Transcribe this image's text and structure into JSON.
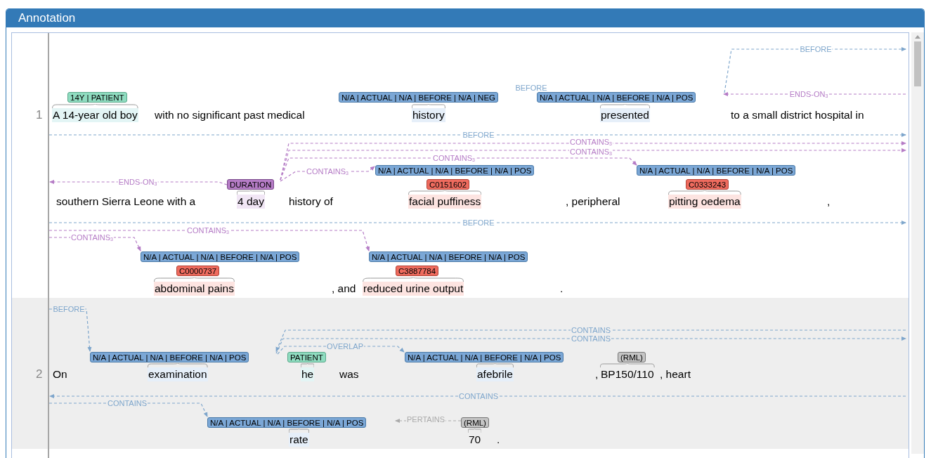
{
  "panel": {
    "title": "Annotation"
  },
  "lines": [
    {
      "number": "1",
      "shaded": false,
      "tokens": [
        {
          "text": "A 14-year old boy",
          "labels": [
            {
              "text": "14Y | PATIENT",
              "kind": "patient"
            }
          ]
        },
        {
          "text": "with no significant past medical"
        },
        {
          "text": "history",
          "labels": [
            {
              "text": "N/A | ACTUAL | N/A | BEFORE | N/A | NEG",
              "kind": "event"
            }
          ]
        },
        {
          "text": "presented",
          "labels": [
            {
              "text": "N/A | ACTUAL | N/A | BEFORE | N/A | POS",
              "kind": "event"
            }
          ]
        },
        {
          "text": "to a small district hospital in"
        }
      ],
      "arcs": [
        {
          "label": "BEFORE",
          "color": "#7ea6cc"
        },
        {
          "label": "BEFORE",
          "color": "#7ea6cc"
        },
        {
          "label": "ENDS-ON$_{3}$",
          "color": "#b57cc6"
        }
      ]
    },
    {
      "shaded": false,
      "tokens": [
        {
          "text": "southern Sierra Leone with a"
        },
        {
          "text": "4 day",
          "labels": [
            {
              "text": "DURATION",
              "kind": "duration"
            }
          ]
        },
        {
          "text": "history of"
        },
        {
          "text": "facial puffiness",
          "labels": [
            {
              "text": "N/A | ACTUAL | N/A | BEFORE | N/A | POS",
              "kind": "event"
            },
            {
              "text": "C0151602",
              "kind": "concept"
            }
          ]
        },
        {
          "text": ", peripheral"
        },
        {
          "text": "pitting oedema",
          "labels": [
            {
              "text": "N/A | ACTUAL | N/A | BEFORE | N/A | POS",
              "kind": "event"
            },
            {
              "text": "C0333243",
              "kind": "concept"
            }
          ]
        },
        {
          "text": ","
        }
      ],
      "arcs": [
        {
          "label": "BEFORE",
          "color": "#7ea6cc"
        },
        {
          "label": "CONTAINS$_{3}$",
          "color": "#b57cc6"
        },
        {
          "label": "CONTAINS$_{3}$",
          "color": "#b57cc6"
        },
        {
          "label": "CONTAINS$_{3}$",
          "color": "#b57cc6"
        },
        {
          "label": "CONTAINS$_{3}$",
          "color": "#b57cc6"
        },
        {
          "label": "ENDS-ON$_{3}$",
          "color": "#b57cc6"
        }
      ]
    },
    {
      "shaded": false,
      "tokens": [
        {
          "text": "abdominal pains",
          "labels": [
            {
              "text": "N/A | ACTUAL | N/A | BEFORE | N/A | POS",
              "kind": "event"
            },
            {
              "text": "C0000737",
              "kind": "concept"
            }
          ]
        },
        {
          "text": ", and"
        },
        {
          "text": "reduced urine output",
          "labels": [
            {
              "text": "N/A | ACTUAL | N/A | BEFORE | N/A | POS",
              "kind": "event"
            },
            {
              "text": "C3887784",
              "kind": "concept"
            }
          ]
        },
        {
          "text": "."
        }
      ],
      "arcs": [
        {
          "label": "BEFORE",
          "color": "#7ea6cc"
        },
        {
          "label": "CONTAINS$_{3}$",
          "color": "#b57cc6"
        },
        {
          "label": "CONTAINS$_{3}$",
          "color": "#b57cc6"
        }
      ]
    },
    {
      "number": "2",
      "shaded": true,
      "tokens": [
        {
          "text": "On"
        },
        {
          "text": "examination",
          "labels": [
            {
              "text": "N/A | ACTUAL | N/A | BEFORE | N/A | POS",
              "kind": "event"
            }
          ]
        },
        {
          "text": "he",
          "labels": [
            {
              "text": "PATIENT",
              "kind": "patient"
            }
          ]
        },
        {
          "text": "was"
        },
        {
          "text": "afebrile",
          "labels": [
            {
              "text": "N/A | ACTUAL | N/A | BEFORE | N/A | POS",
              "kind": "event"
            }
          ]
        },
        {
          "text": ","
        },
        {
          "text": "BP150/110",
          "labels": [
            {
              "text": "(RML)",
              "kind": "rml"
            }
          ]
        },
        {
          "text": ", heart"
        }
      ],
      "arcs": [
        {
          "label": "BEFORE",
          "color": "#7ea6cc"
        },
        {
          "label": "CONTAINS",
          "color": "#7ea6cc"
        },
        {
          "label": "CONTAINS",
          "color": "#7ea6cc"
        },
        {
          "label": "OVERLAP",
          "color": "#7ea6cc"
        }
      ]
    },
    {
      "shaded": true,
      "tokens": [
        {
          "text": "rate",
          "labels": [
            {
              "text": "N/A | ACTUAL | N/A | BEFORE | N/A | POS",
              "kind": "event"
            }
          ]
        },
        {
          "text": "70",
          "labels": [
            {
              "text": "(RML)",
              "kind": "rml"
            }
          ]
        },
        {
          "text": "."
        }
      ],
      "arcs": [
        {
          "label": "CONTAINS",
          "color": "#7ea6cc"
        },
        {
          "label": "CONTAINS",
          "color": "#7ea6cc"
        },
        {
          "label": "PERTAINS",
          "color": "#aaaaaa"
        }
      ]
    }
  ]
}
